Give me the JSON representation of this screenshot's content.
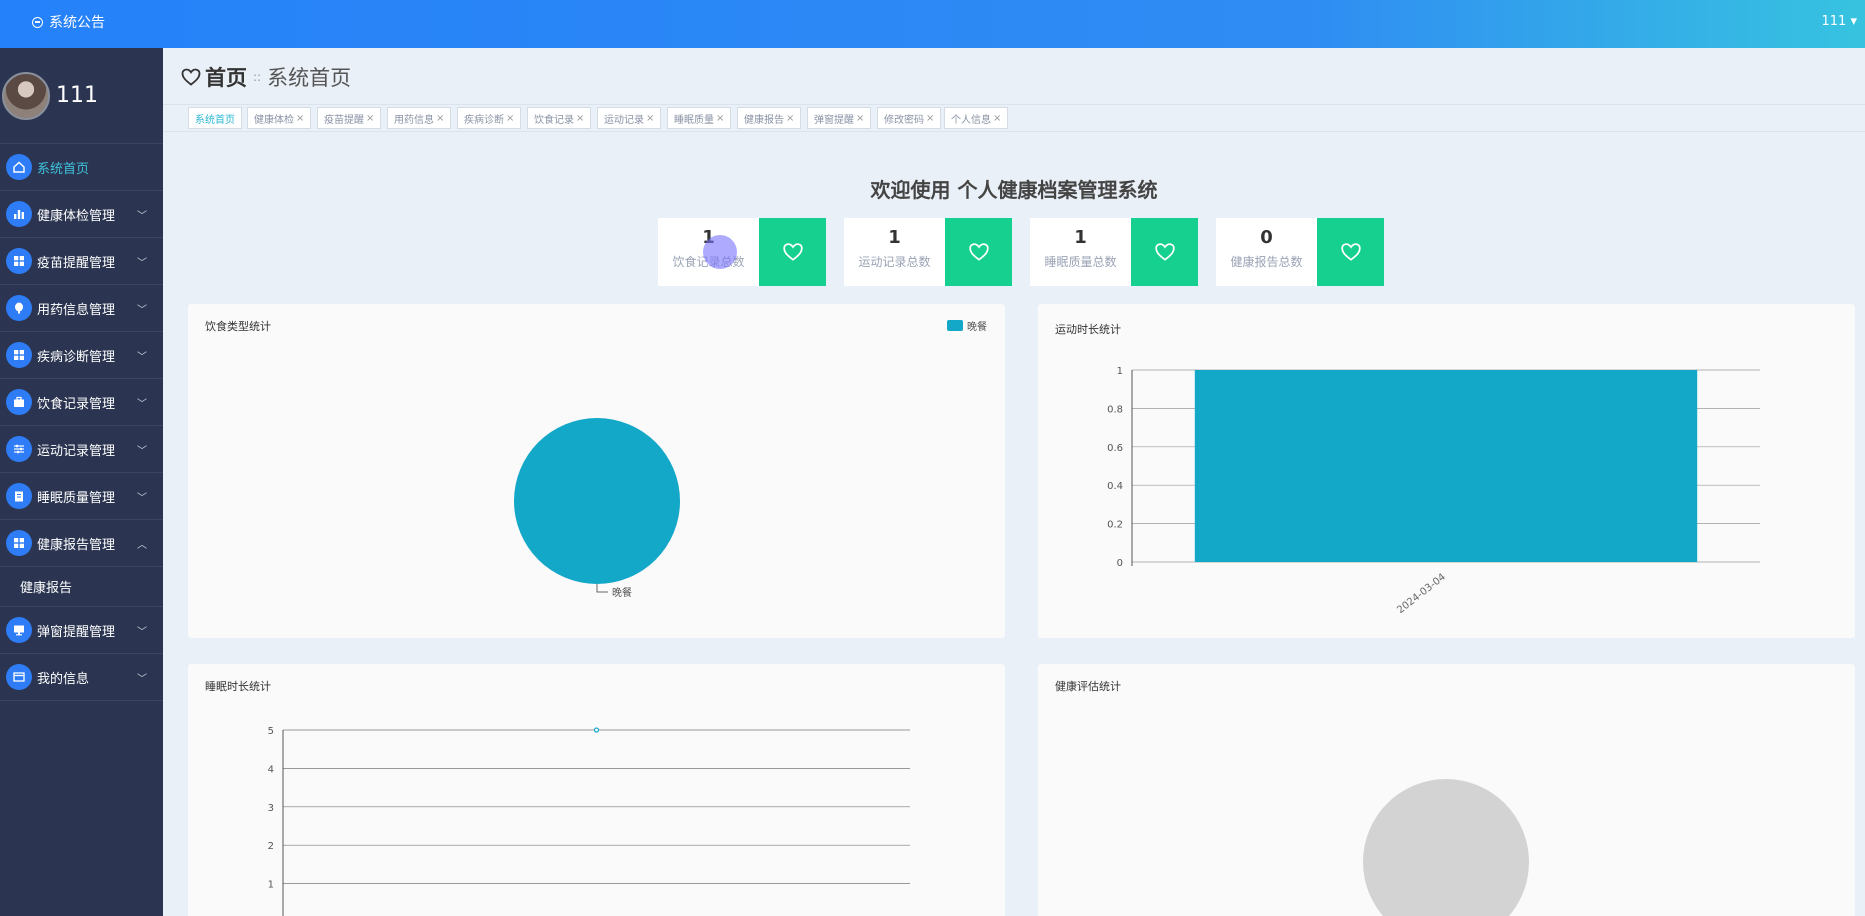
{
  "topbar": {
    "notice_label": "系统公告",
    "user_label": "111 ▾"
  },
  "sidebar": {
    "profile_name": "111",
    "items": [
      {
        "label": "系统首页",
        "icon": "home-icon"
      },
      {
        "label": "健康体检管理",
        "icon": "bar-chart-icon"
      },
      {
        "label": "疫苗提醒管理",
        "icon": "grid-icon"
      },
      {
        "label": "用药信息管理",
        "icon": "pill-icon"
      },
      {
        "label": "疾病诊断管理",
        "icon": "grid-icon"
      },
      {
        "label": "饮食记录管理",
        "icon": "briefcase-icon"
      },
      {
        "label": "运动记录管理",
        "icon": "sliders-icon"
      },
      {
        "label": "睡眠质量管理",
        "icon": "clipboard-icon"
      },
      {
        "label": "健康报告管理",
        "icon": "grid-icon"
      },
      {
        "label": "健康报告"
      },
      {
        "label": "弹窗提醒管理",
        "icon": "monitor-icon"
      },
      {
        "label": "我的信息",
        "icon": "card-icon"
      }
    ]
  },
  "header": {
    "home": "首页",
    "separator": "::",
    "current": "系统首页"
  },
  "tabs": [
    "系统首页",
    "健康体检",
    "疫苗提醒",
    "用药信息",
    "疾病诊断",
    "饮食记录",
    "运动记录",
    "睡眠质量",
    "健康报告",
    "弹窗提醒",
    "修改密码",
    "个人信息"
  ],
  "welcome": "欢迎使用 个人健康档案管理系统",
  "stats": [
    {
      "value": "1",
      "label": "饮食记录总数"
    },
    {
      "value": "1",
      "label": "运动记录总数"
    },
    {
      "value": "1",
      "label": "睡眠质量总数"
    },
    {
      "value": "0",
      "label": "健康报告总数"
    }
  ],
  "colors": {
    "accent": "#2e7cf6",
    "stat_button": "#16d08f",
    "chart": "#13a7c8",
    "sidebar": "#2b3551"
  },
  "chart_data": [
    {
      "type": "pie",
      "title": "饮食类型统计",
      "categories": [
        "晚餐"
      ],
      "values": [
        1
      ],
      "legend": "top-right"
    },
    {
      "type": "bar",
      "title": "运动时长统计",
      "categories": [
        "2024-03-04"
      ],
      "values": [
        1
      ],
      "ylim": [
        0,
        1
      ],
      "yticks": [
        "0",
        "0.2",
        "0.4",
        "0.6",
        "0.8",
        "1"
      ],
      "grid": true
    },
    {
      "type": "line",
      "title": "睡眠时长统计",
      "values": [
        5
      ],
      "ylim": [
        0,
        5
      ],
      "yticks": [
        "1",
        "2",
        "3",
        "4",
        "5"
      ],
      "grid": true
    },
    {
      "type": "pie",
      "title": "健康评估统计",
      "categories": [],
      "values": []
    }
  ]
}
